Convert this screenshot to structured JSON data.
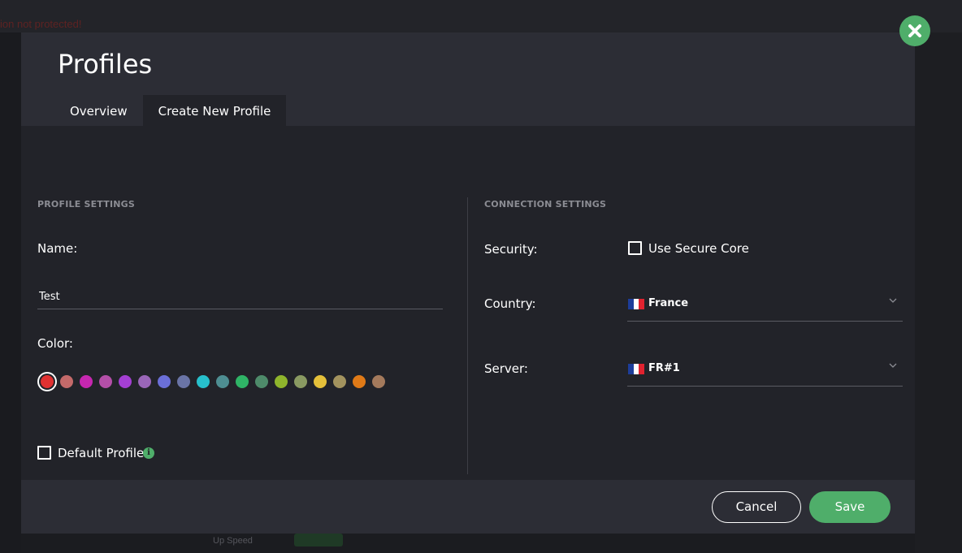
{
  "background": {
    "red_text": "ion not protected!",
    "bottom_label": "Up Speed"
  },
  "modal": {
    "title": "Profiles",
    "tabs": [
      {
        "label": "Overview",
        "active": false
      },
      {
        "label": "Create New Profile",
        "active": true
      }
    ]
  },
  "profile_settings": {
    "section_label": "PROFILE SETTINGS",
    "name_label": "Name:",
    "name_value": "Test",
    "color_label": "Color:",
    "colors": [
      "#e03131",
      "#c46a6a",
      "#c627b0",
      "#b44fa8",
      "#a43fd3",
      "#9a66b8",
      "#6b6fd8",
      "#6a74a6",
      "#27c0cc",
      "#4e8e92",
      "#2fb466",
      "#4e8b6a",
      "#8fb52c",
      "#8a9a62",
      "#e5c03a",
      "#a3935e",
      "#e07a17",
      "#a47a5c"
    ],
    "selected_color_index": 0,
    "default_profile_label": "Default Profile",
    "default_profile_checked": false,
    "info_icon": "info-icon"
  },
  "connection_settings": {
    "section_label": "CONNECTION SETTINGS",
    "security_label": "Security:",
    "secure_core_label": "Use Secure Core",
    "secure_core_checked": false,
    "country_label": "Country:",
    "country_value": "France",
    "server_label": "Server:",
    "server_value": "FR#1",
    "flag_colors": [
      "#1d3d9a",
      "#ffffff",
      "#e1222f"
    ]
  },
  "footer": {
    "cancel_label": "Cancel",
    "save_label": "Save"
  },
  "accent_color": "#4fae6a"
}
